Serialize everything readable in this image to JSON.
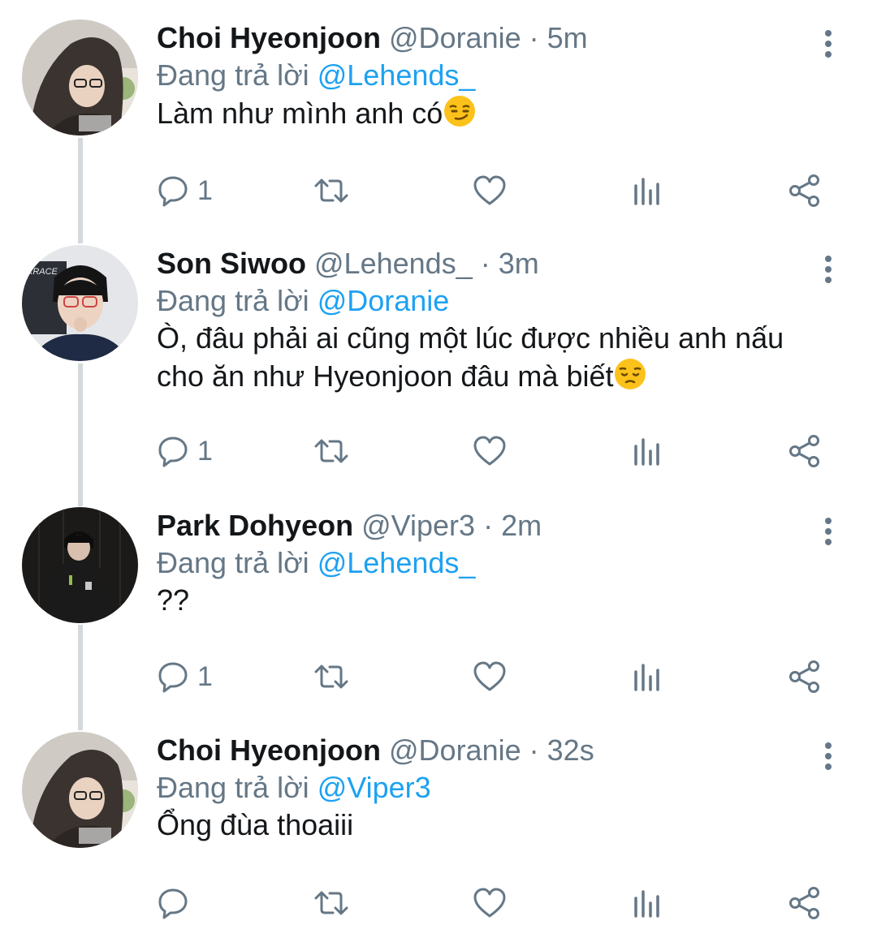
{
  "tweets": [
    {
      "name": "Choi Hyeonjoon",
      "handle": "@Doranie",
      "separator": "·",
      "time": "5m",
      "reply_prefix": "Đang trả lời",
      "reply_to": "@Lehends_",
      "text": "Làm như mình anh có",
      "emoji": "smirk",
      "reply_count": "1",
      "avatar": "avatar-hoodie"
    },
    {
      "name": "Son Siwoo",
      "handle": "@Lehends_",
      "separator": "·",
      "time": "3m",
      "reply_prefix": "Đang trả lời",
      "reply_to": "@Doranie",
      "text": "Ò, đâu phải ai cũng một lúc được nhiều anh nấu cho ăn như Hyeonjoon đâu mà biết",
      "emoji": "pensive",
      "reply_count": "1",
      "avatar": "avatar-glasses"
    },
    {
      "name": "Park Dohyeon",
      "handle": "@Viper3",
      "separator": "·",
      "time": "2m",
      "reply_prefix": "Đang trả lời",
      "reply_to": "@Lehends_",
      "text": "??",
      "emoji": "",
      "reply_count": "1",
      "avatar": "avatar-dark"
    },
    {
      "name": "Choi Hyeonjoon",
      "handle": "@Doranie",
      "separator": "·",
      "time": "32s",
      "reply_prefix": "Đang trả lời",
      "reply_to": "@Viper3",
      "text": "Ổng đùa thoaiii",
      "emoji": "",
      "reply_count": "",
      "avatar": "avatar-hoodie"
    }
  ],
  "icons": {
    "reply": "comment-icon",
    "retweet": "retweet-icon",
    "like": "heart-icon",
    "analytics": "analytics-icon",
    "share": "share-icon",
    "more": "more-vertical-icon"
  },
  "colors": {
    "text": "#14171a",
    "secondary": "#657786",
    "mention": "#1da1f2",
    "thread_line": "#d4d9dd"
  }
}
